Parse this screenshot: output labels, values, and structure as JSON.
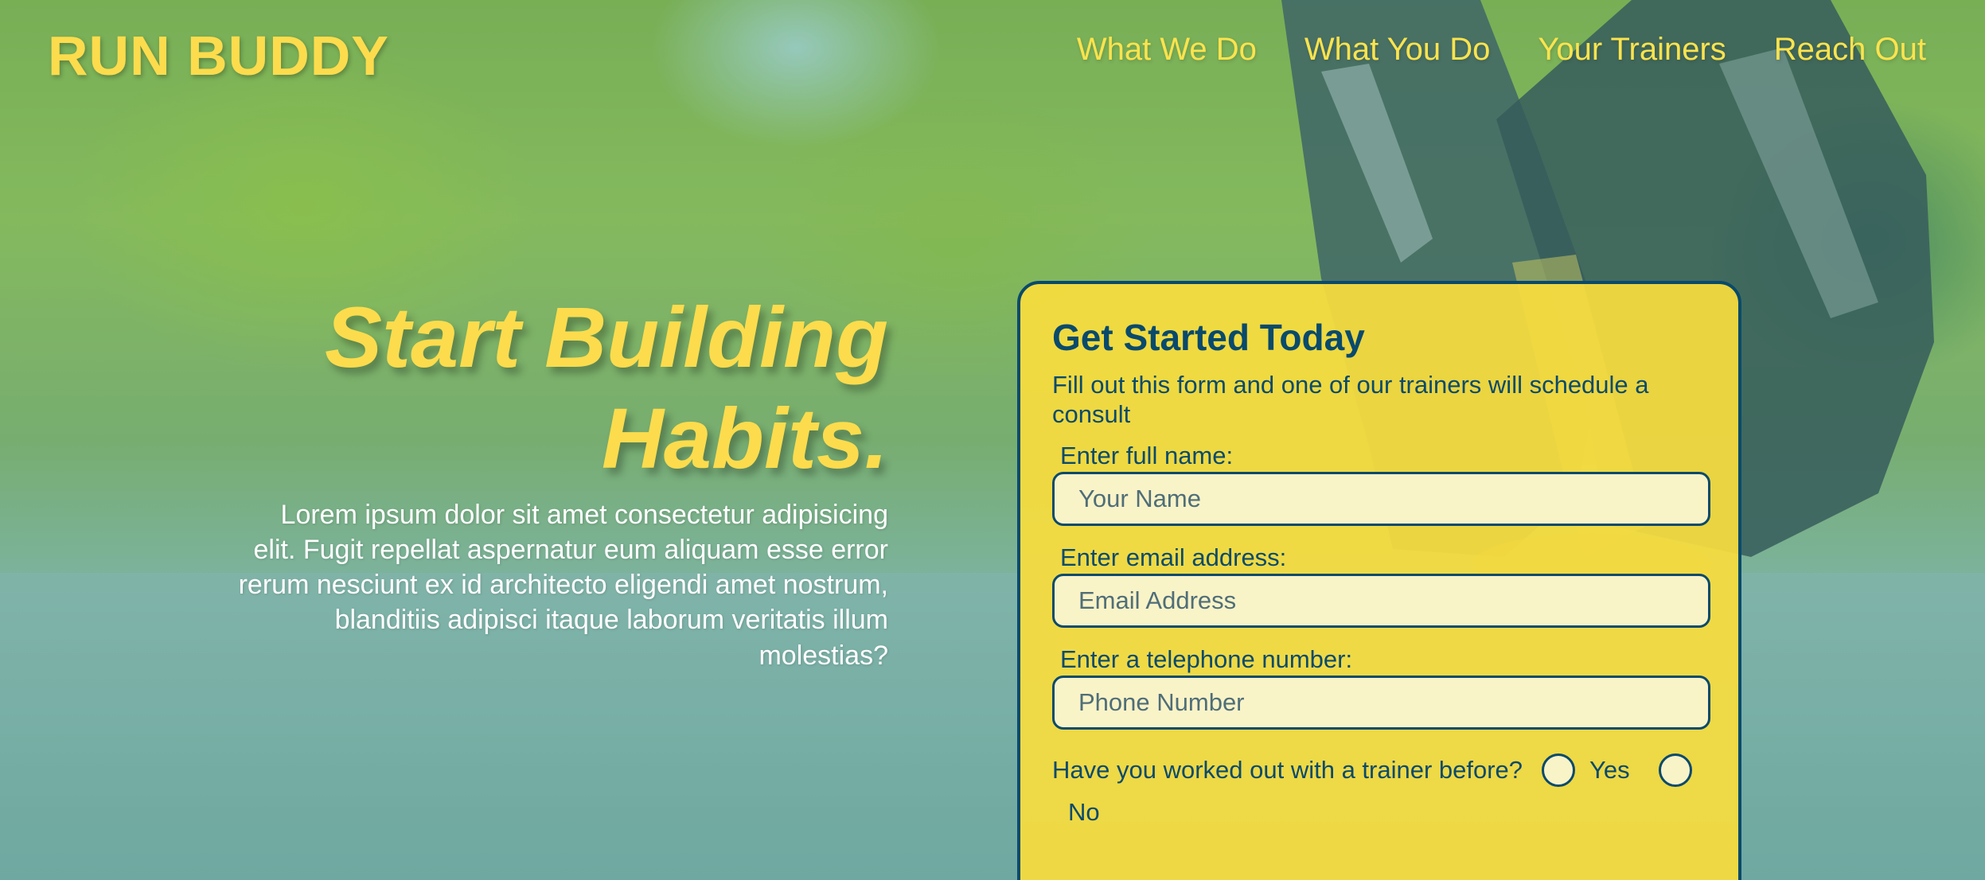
{
  "brand": {
    "name": "RUN BUDDY"
  },
  "nav": {
    "items": [
      {
        "label": "What We Do"
      },
      {
        "label": "What You Do"
      },
      {
        "label": "Your Trainers"
      },
      {
        "label": "Reach Out"
      }
    ]
  },
  "hero": {
    "title_line1": "Start Building",
    "title_line2": "Habits.",
    "body": "Lorem ipsum dolor sit amet consectetur adipisicing elit. Fugit repellat aspernatur eum aliquam esse error rerum nesciunt ex id architecto eligendi amet nostrum, blanditiis adipisci itaque laborum veritatis illum molestias?"
  },
  "form": {
    "title": "Get Started Today",
    "subtitle": "Fill out this form and one of our trainers will schedule a consult",
    "fields": [
      {
        "label": "Enter full name:",
        "placeholder": "Your Name",
        "value": ""
      },
      {
        "label": "Enter email address:",
        "placeholder": "Email Address",
        "value": ""
      },
      {
        "label": "Enter a telephone number:",
        "placeholder": "Phone Number",
        "value": ""
      }
    ],
    "trainer_question": "Have you worked out with a trainer before?",
    "option_yes": "Yes",
    "option_no": "No"
  },
  "colors": {
    "accent_yellow": "#fcdc4d",
    "navy": "#094a6c",
    "card_bg": "#f8dd3e",
    "input_bg": "#f9f3c8"
  }
}
